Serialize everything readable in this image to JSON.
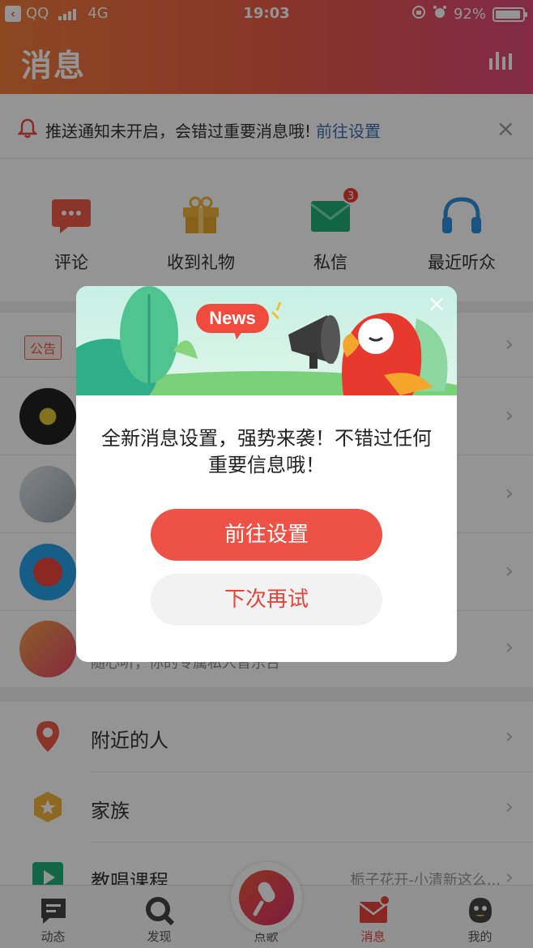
{
  "status_bar": {
    "carrier": "QQ",
    "network": "4G",
    "time": "19:03",
    "battery": "92%"
  },
  "header": {
    "title": "消息",
    "icons": [
      "bar-chart-icon"
    ]
  },
  "notice": {
    "text": "推送通知未开启，会错过重要消息哦!",
    "link": "前往设置",
    "close": "×"
  },
  "tiles": [
    {
      "label": "评论",
      "icon": "comment-icon"
    },
    {
      "label": "收到礼物",
      "icon": "gift-icon"
    },
    {
      "label": "私信",
      "icon": "mail-icon",
      "badge": "3"
    },
    {
      "label": "最近听众",
      "icon": "headphones-icon"
    }
  ],
  "message_list": {
    "announcement_tag": "公告",
    "last_row_subtitle": "随心听，你的专属私人音乐台",
    "chevron": "›"
  },
  "menu": [
    {
      "label": "附近的人",
      "icon": "location-pin-icon"
    },
    {
      "label": "家族",
      "icon": "star-hexagon-icon"
    },
    {
      "label": "教唱课程",
      "icon": "play-square-icon",
      "extra": "栀子花开-小清新这么..."
    }
  ],
  "tabbar": [
    {
      "label": "动态",
      "icon": "message-square-icon"
    },
    {
      "label": "发现",
      "icon": "search-icon"
    },
    {
      "label": "点歌",
      "icon": "microphone-icon"
    },
    {
      "label": "消息",
      "icon": "envelope-icon",
      "active": true
    },
    {
      "label": "我的",
      "icon": "penguin-icon"
    }
  ],
  "dialog": {
    "banner_badge": "News",
    "message": "全新消息设置，强势来袭！不错过任何重要信息哦！",
    "primary_button": "前往设置",
    "secondary_button": "下次再试",
    "close": "×"
  },
  "colors": {
    "brand": "#ec5a4a",
    "primary_button": "#ee5145",
    "link": "#3b6fb6"
  }
}
